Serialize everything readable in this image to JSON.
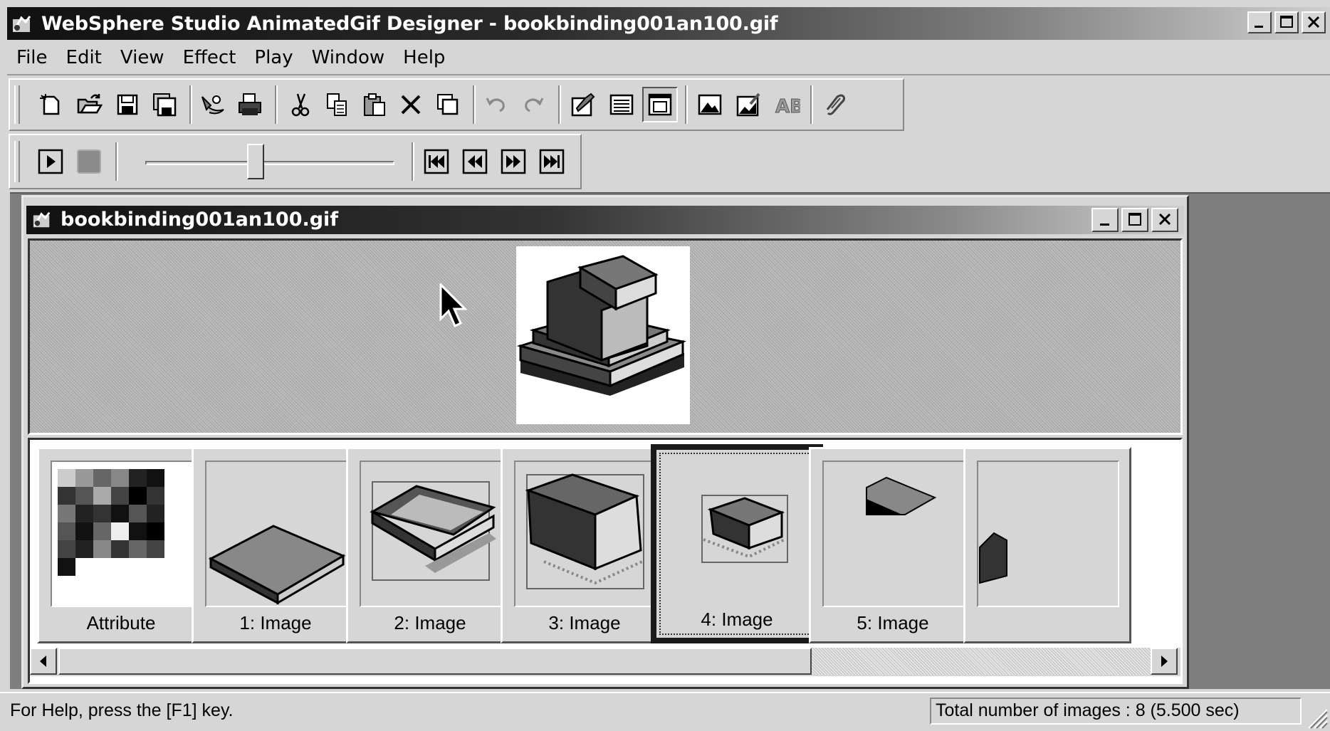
{
  "app": {
    "title": "WebSphere Studio AnimatedGif Designer - bookbinding001an100.gif"
  },
  "menu": [
    "File",
    "Edit",
    "View",
    "Effect",
    "Play",
    "Window",
    "Help"
  ],
  "document": {
    "title": "bookbinding001an100.gif"
  },
  "frames": [
    {
      "label": "Attribute"
    },
    {
      "label": "1: Image"
    },
    {
      "label": "2: Image"
    },
    {
      "label": "3: Image"
    },
    {
      "label": "4: Image",
      "selected": true
    },
    {
      "label": "5: Image"
    }
  ],
  "status": {
    "help": "For Help, press the [F1] key.",
    "total": "Total number of images : 8 (5.500 sec)"
  },
  "playback": {
    "speed_slider_fraction": 0.44
  },
  "icons": {
    "toolbar1": [
      "new-icon",
      "open-icon",
      "save-icon",
      "save-all-icon",
      "wizard-icon",
      "print-icon",
      "cut-icon",
      "copy-icon",
      "paste-icon",
      "delete-icon",
      "duplicate-icon",
      "undo-icon",
      "redo-icon",
      "properties-icon",
      "list-view-icon",
      "preview-view-icon",
      "insert-image-icon",
      "edit-image-icon",
      "text-effect-icon",
      "link-icon"
    ],
    "toolbar2": [
      "play-icon",
      "stop-icon",
      "first-frame-icon",
      "previous-frame-icon",
      "next-frame-icon",
      "last-frame-icon"
    ]
  }
}
